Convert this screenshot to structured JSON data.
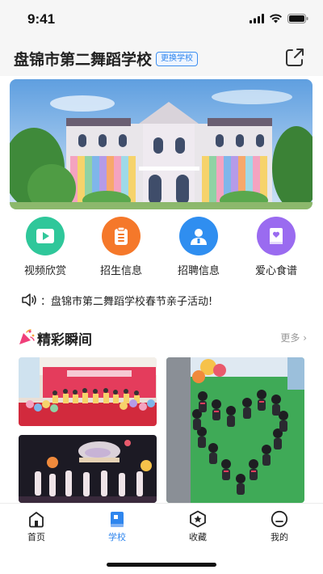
{
  "status_bar": {
    "time": "9:41"
  },
  "header": {
    "school_name": "盘锦市第二舞蹈学校",
    "switch_label": "更换学校"
  },
  "quick_links": [
    {
      "label": "视频欣赏",
      "icon": "play-video-icon",
      "color": "#2fc79a"
    },
    {
      "label": "招生信息",
      "icon": "clipboard-icon",
      "color": "#f5782a"
    },
    {
      "label": "招聘信息",
      "icon": "person-icon",
      "color": "#2f8ef0"
    },
    {
      "label": "爱心食谱",
      "icon": "recipe-book-icon",
      "color": "#9a6bf0"
    }
  ],
  "notice": {
    "text": "：盘锦市第二舞蹈学校春节亲子活动!"
  },
  "highlights": {
    "title": "精彩瞬间",
    "more_label": "更多"
  },
  "tabs": [
    {
      "label": "首页",
      "icon": "home-icon",
      "active": false
    },
    {
      "label": "学校",
      "icon": "school-book-icon",
      "active": true
    },
    {
      "label": "收藏",
      "icon": "star-icon",
      "active": false
    },
    {
      "label": "我的",
      "icon": "profile-icon",
      "active": false
    }
  ],
  "colors": {
    "accent": "#2f86ee",
    "notice_icon": "#222222"
  }
}
